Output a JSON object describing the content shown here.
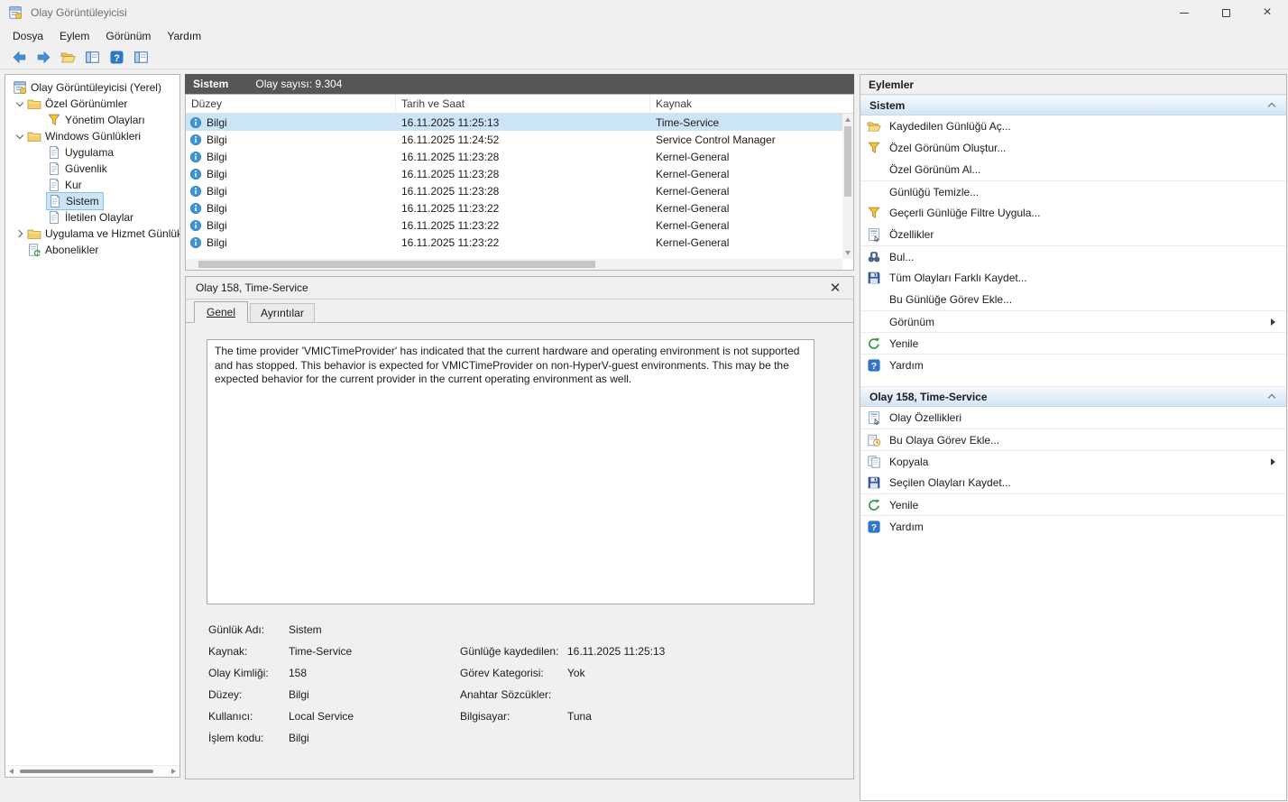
{
  "window": {
    "title": "Olay Görüntüleyicisi"
  },
  "colors": {
    "list_header_bg": "#565656",
    "selected_row_bg": "#cbe4f6",
    "tree_selection_bg": "#cce4f7",
    "action_section_header_bg": "#d4e5f5",
    "accent_blue": "#3076c5"
  },
  "menubar": {
    "items": [
      "Dosya",
      "Eylem",
      "Görünüm",
      "Yardım"
    ]
  },
  "toolbar": {
    "icons": [
      "back-icon",
      "forward-icon",
      "open-saved-log-icon",
      "console-tree-icon",
      "help-icon",
      "action-pane-icon"
    ]
  },
  "tree": {
    "items": [
      {
        "label": "Olay Görüntüleyicisi (Yerel)",
        "icon": "event-viewer-icon"
      },
      {
        "label": "Özel Görünümler",
        "icon": "folder-icon",
        "state": "expanded"
      },
      {
        "label": "Yönetim Olayları",
        "icon": "filter-icon"
      },
      {
        "label": "Windows Günlükleri",
        "icon": "folder-icon",
        "state": "expanded"
      },
      {
        "label": "Uygulama",
        "icon": "log-icon"
      },
      {
        "label": "Güvenlik",
        "icon": "log-icon"
      },
      {
        "label": "Kur",
        "icon": "log-icon"
      },
      {
        "label": "Sistem",
        "icon": "log-icon",
        "selected": true
      },
      {
        "label": "İletilen Olaylar",
        "icon": "log-icon"
      },
      {
        "label": "Uygulama ve Hizmet Günlükleri",
        "icon": "folder-icon",
        "state": "collapsed"
      },
      {
        "label": "Abonelikler",
        "icon": "subscriptions-icon"
      }
    ]
  },
  "event_list": {
    "log_name": "Sistem",
    "count_text": "Olay sayısı: 9.304",
    "columns": [
      "Düzey",
      "Tarih ve Saat",
      "Kaynak"
    ],
    "rows": [
      {
        "level": "Bilgi",
        "datetime": "16.11.2025 11:25:13",
        "source": "Time-Service",
        "selected": true
      },
      {
        "level": "Bilgi",
        "datetime": "16.11.2025 11:24:52",
        "source": "Service Control Manager"
      },
      {
        "level": "Bilgi",
        "datetime": "16.11.2025 11:23:28",
        "source": "Kernel-General"
      },
      {
        "level": "Bilgi",
        "datetime": "16.11.2025 11:23:28",
        "source": "Kernel-General"
      },
      {
        "level": "Bilgi",
        "datetime": "16.11.2025 11:23:28",
        "source": "Kernel-General"
      },
      {
        "level": "Bilgi",
        "datetime": "16.11.2025 11:23:22",
        "source": "Kernel-General"
      },
      {
        "level": "Bilgi",
        "datetime": "16.11.2025 11:23:22",
        "source": "Kernel-General"
      },
      {
        "level": "Bilgi",
        "datetime": "16.11.2025 11:23:22",
        "source": "Kernel-General"
      }
    ]
  },
  "detail": {
    "title": "Olay 158, Time-Service",
    "tabs": {
      "general": "Genel",
      "details": "Ayrıntılar"
    },
    "active_tab": "Genel",
    "message": "The time provider 'VMICTimeProvider' has indicated that the current hardware and operating environment is not supported and has stopped. This behavior is expected for VMICTimeProvider on non-HyperV-guest environments. This may be the expected behavior for the current provider in the current operating environment as well.",
    "fields": [
      {
        "l1": "Günlük Adı:",
        "v1": "Sistem",
        "l2": "",
        "v2": ""
      },
      {
        "l1": "Kaynak:",
        "v1": "Time-Service",
        "l2": "Günlüğe kaydedilen:",
        "v2": "16.11.2025 11:25:13"
      },
      {
        "l1": "Olay Kimliği:",
        "v1": "158",
        "l2": "Görev Kategorisi:",
        "v2": "Yok"
      },
      {
        "l1": "Düzey:",
        "v1": "Bilgi",
        "l2": "Anahtar Sözcükler:",
        "v2": ""
      },
      {
        "l1": "Kullanıcı:",
        "v1": "Local Service",
        "l2": "Bilgisayar:",
        "v2": "Tuna"
      },
      {
        "l1": "İşlem kodu:",
        "v1": "Bilgi",
        "l2": "",
        "v2": ""
      }
    ]
  },
  "actions": {
    "title": "Eylemler",
    "sections": [
      {
        "header": "Sistem",
        "items": [
          {
            "label": "Kaydedilen Günlüğü Aç...",
            "icon": "open-folder-icon"
          },
          {
            "label": "Özel Görünüm Oluştur...",
            "icon": "filter-icon"
          },
          {
            "label": "Özel Görünüm Al...",
            "icon": ""
          },
          {
            "label": "Günlüğü Temizle...",
            "icon": ""
          },
          {
            "label": "Geçerli Günlüğe Filtre Uygula...",
            "icon": "filter-icon"
          },
          {
            "label": "Özellikler",
            "icon": "properties-icon"
          },
          {
            "label": "Bul...",
            "icon": "find-icon"
          },
          {
            "label": "Tüm Olayları Farklı Kaydet...",
            "icon": "save-icon"
          },
          {
            "label": "Bu Günlüğe Görev Ekle...",
            "icon": ""
          },
          {
            "label": "Görünüm",
            "icon": "",
            "submenu": true
          },
          {
            "label": "Yenile",
            "icon": "refresh-icon"
          },
          {
            "label": "Yardım",
            "icon": "help-icon"
          }
        ]
      },
      {
        "header": "Olay 158, Time-Service",
        "items": [
          {
            "label": "Olay Özellikleri",
            "icon": "properties-icon"
          },
          {
            "label": "Bu Olaya Görev Ekle...",
            "icon": "task-icon"
          },
          {
            "label": "Kopyala",
            "icon": "copy-icon",
            "submenu": true
          },
          {
            "label": "Seçilen Olayları Kaydet...",
            "icon": "save-icon"
          },
          {
            "label": "Yenile",
            "icon": "refresh-icon"
          },
          {
            "label": "Yardım",
            "icon": "help-icon"
          }
        ]
      }
    ]
  }
}
